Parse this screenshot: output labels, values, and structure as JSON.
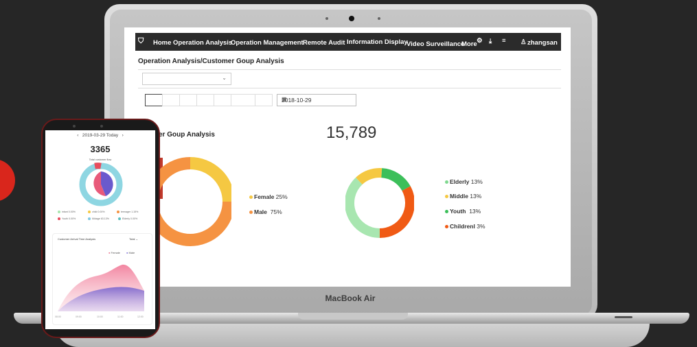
{
  "laptop": {
    "brand_label": "MacBook Air"
  },
  "app": {
    "nav": {
      "items": [
        "Home",
        "Operation Analysis",
        "Operation Management",
        "Remote Audit",
        "Information Display",
        "Video Surveillance",
        "More"
      ],
      "user": "zhangsan"
    },
    "breadcrumb": "Operation Analysis/Customer Goup Analysis",
    "date_value": "2018-10-29",
    "section_title": "er Goup Analysis",
    "total": "15,789",
    "gender_legend": [
      {
        "label": "Female",
        "value": "25%",
        "color": "#f5c842"
      },
      {
        "label": "Male",
        "value": "75%",
        "color": "#f59342"
      }
    ],
    "age_legend": [
      {
        "label": "Elderly",
        "value": "13%",
        "color": "#7fd88f"
      },
      {
        "label": "Middle",
        "value": "13%",
        "color": "#f5c842"
      },
      {
        "label": "Youth",
        "value": "13%",
        "color": "#3cbf5a"
      },
      {
        "label": "Childrenl",
        "value": "3%",
        "color": "#f05a14"
      }
    ]
  },
  "chart_data": [
    {
      "type": "pie",
      "categories": [
        "Female",
        "Male"
      ],
      "values": [
        25,
        75
      ],
      "colors": [
        "#f5c842",
        "#f59342"
      ]
    },
    {
      "type": "pie",
      "categories": [
        "Elderly",
        "Middle",
        "Youth",
        "Childrenl"
      ],
      "values": [
        38,
        13,
        16,
        33
      ],
      "colors": [
        "#a8e6b0",
        "#f5c842",
        "#3cbf5a",
        "#f05a14"
      ]
    }
  ],
  "phone": {
    "date": "2019-03-29",
    "today": "Today",
    "total": "3365",
    "subtitle": "Total customer flow",
    "legend": [
      {
        "label": "infant",
        "value": "0.00%",
        "color": "#a8e6b0"
      },
      {
        "label": "child",
        "value": "0.00%",
        "color": "#f5c842"
      },
      {
        "label": "teenager",
        "value": "1.15%",
        "color": "#f59342"
      },
      {
        "label": "Youth",
        "value": "0.00%",
        "color": "#e74c5c"
      },
      {
        "label": "Midage",
        "value": "63.13%",
        "color": "#7ec8e3"
      },
      {
        "label": "Elderly",
        "value": "0.00%",
        "color": "#5bc0be"
      }
    ],
    "card_title": "Customer Arrival Time Analysis",
    "card_total": "Total",
    "card_legend": [
      "Female",
      "Male"
    ],
    "x_ticks": [
      "08:00",
      "09:00",
      "10:00",
      "11:00",
      "12:00"
    ]
  }
}
